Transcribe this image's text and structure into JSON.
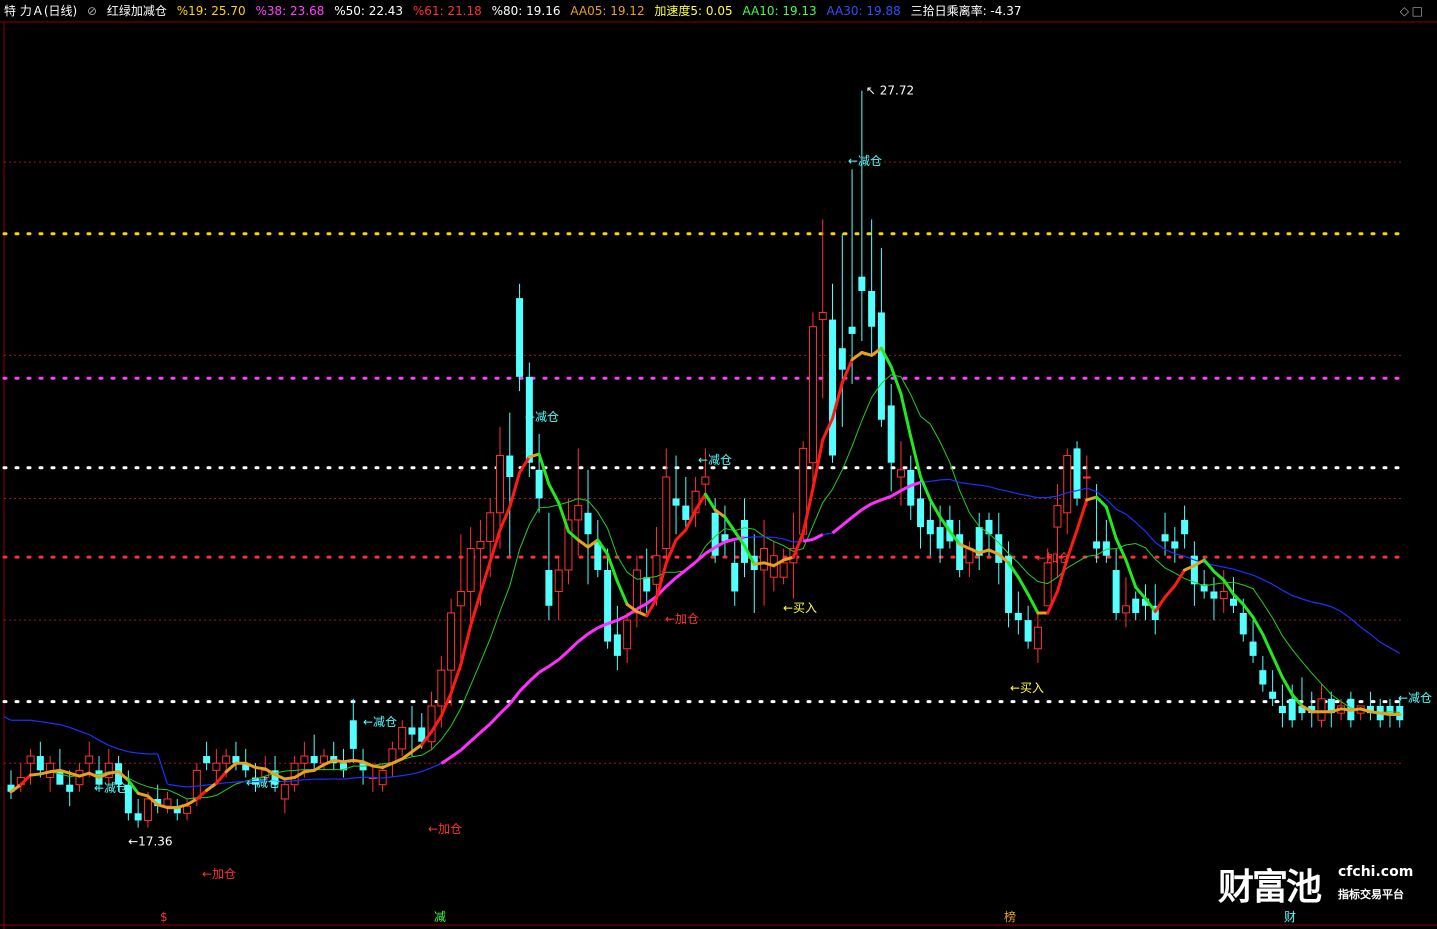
{
  "header": {
    "stock": "特 力Ａ(日线)",
    "indicator": "红绿加减仓",
    "items": [
      {
        "label": "%19: 25.70",
        "color": "#ffd400"
      },
      {
        "label": "%38: 23.68",
        "color": "#ff40ff"
      },
      {
        "label": "%50: 22.43",
        "color": "#ffffff"
      },
      {
        "label": "%61: 21.18",
        "color": "#ff3030"
      },
      {
        "label": "%80: 19.16",
        "color": "#ffffff"
      },
      {
        "label": "AA05: 19.12",
        "color": "#e8a020"
      },
      {
        "label": "加速度5: 0.05",
        "color": "#ffff40"
      },
      {
        "label": "AA10: 19.13",
        "color": "#40ff40"
      },
      {
        "label": "AA30: 19.88",
        "color": "#3050ff"
      },
      {
        "label": "三拾日乘离率: -4.37",
        "color": "#ffffff"
      }
    ]
  },
  "colors": {
    "up": "#ff3232",
    "down": "#54ffff",
    "ma5_rise": "#ff1a1a",
    "ma5_fall": "#22e822",
    "ma5_flat": "#e8a020",
    "ma10": "#22cc22",
    "ma30": "#2030ff",
    "ma30_up": "#ff30ff"
  },
  "chart_data": {
    "type": "candlestick",
    "ylim": [
      16.5,
      28.1
    ],
    "high_label": "27.72",
    "low_label": "17.36",
    "levels": [
      {
        "value": 25.7,
        "color": "#ffd400",
        "style": "dotted"
      },
      {
        "value": 23.68,
        "color": "#ff40ff",
        "style": "dotted"
      },
      {
        "value": 22.43,
        "color": "#ffffff",
        "style": "dotted"
      },
      {
        "value": 21.18,
        "color": "#ff3030",
        "style": "dotted"
      },
      {
        "value": 19.16,
        "color": "#ffffff",
        "style": "dotted"
      }
    ],
    "gridlines": [
      26.7,
      24.0,
      22.0,
      20.3,
      18.3
    ],
    "candles": [
      [
        18.0,
        18.2,
        17.8,
        17.9
      ],
      [
        18.0,
        18.3,
        17.9,
        18.1
      ],
      [
        18.3,
        18.5,
        18.0,
        18.4
      ],
      [
        18.4,
        18.6,
        18.1,
        18.2
      ],
      [
        18.1,
        18.4,
        17.9,
        18.3
      ],
      [
        18.2,
        18.5,
        18.0,
        18.0
      ],
      [
        18.0,
        18.2,
        17.7,
        17.9
      ],
      [
        18.0,
        18.3,
        17.9,
        18.2
      ],
      [
        18.3,
        18.6,
        18.1,
        18.4
      ],
      [
        18.2,
        18.4,
        17.9,
        18.0
      ],
      [
        18.1,
        18.5,
        18.0,
        18.3
      ],
      [
        18.3,
        18.4,
        17.9,
        18.0
      ],
      [
        18.0,
        18.2,
        17.5,
        17.6
      ],
      [
        17.6,
        17.8,
        17.4,
        17.5
      ],
      [
        17.5,
        17.9,
        17.4,
        17.8
      ],
      [
        17.8,
        18.0,
        17.6,
        17.7
      ],
      [
        17.7,
        17.9,
        17.6,
        17.8
      ],
      [
        17.7,
        17.8,
        17.5,
        17.6
      ],
      [
        17.6,
        17.8,
        17.5,
        17.7
      ],
      [
        17.8,
        18.3,
        17.7,
        18.2
      ],
      [
        18.4,
        18.6,
        18.2,
        18.3
      ],
      [
        18.2,
        18.5,
        18.0,
        18.3
      ],
      [
        18.3,
        18.5,
        18.1,
        18.4
      ],
      [
        18.4,
        18.6,
        18.2,
        18.3
      ],
      [
        18.3,
        18.5,
        18.1,
        18.2
      ],
      [
        18.1,
        18.3,
        17.9,
        18.0
      ],
      [
        18.1,
        18.4,
        18.0,
        18.2
      ],
      [
        18.2,
        18.4,
        17.9,
        18.0
      ],
      [
        17.8,
        18.1,
        17.6,
        18.0
      ],
      [
        18.0,
        18.4,
        17.9,
        18.3
      ],
      [
        18.3,
        18.6,
        18.1,
        18.4
      ],
      [
        18.4,
        18.7,
        18.2,
        18.3
      ],
      [
        18.3,
        18.5,
        18.2,
        18.4
      ],
      [
        18.4,
        18.6,
        18.2,
        18.3
      ],
      [
        18.3,
        18.5,
        18.1,
        18.2
      ],
      [
        18.9,
        19.2,
        18.3,
        18.5
      ],
      [
        18.3,
        18.5,
        18.0,
        18.2
      ],
      [
        18.1,
        18.3,
        17.9,
        18.1
      ],
      [
        18.0,
        18.3,
        17.9,
        18.2
      ],
      [
        18.3,
        18.6,
        18.1,
        18.5
      ],
      [
        18.5,
        18.9,
        18.4,
        18.8
      ],
      [
        18.8,
        19.1,
        18.4,
        18.7
      ],
      [
        18.8,
        19.0,
        18.5,
        18.6
      ],
      [
        18.6,
        19.3,
        18.5,
        19.1
      ],
      [
        19.1,
        19.8,
        18.8,
        19.6
      ],
      [
        19.6,
        20.6,
        19.1,
        20.4
      ],
      [
        20.5,
        21.5,
        19.6,
        20.7
      ],
      [
        20.7,
        21.6,
        20.2,
        21.3
      ],
      [
        21.3,
        21.7,
        20.5,
        21.4
      ],
      [
        21.4,
        22.0,
        20.9,
        21.8
      ],
      [
        21.8,
        23.0,
        21.3,
        22.6
      ],
      [
        22.6,
        23.2,
        21.2,
        22.3
      ],
      [
        24.8,
        25.0,
        23.5,
        23.7
      ],
      [
        23.7,
        23.9,
        22.3,
        22.5
      ],
      [
        22.4,
        22.9,
        21.8,
        22.0
      ],
      [
        21.0,
        21.8,
        20.3,
        20.5
      ],
      [
        20.7,
        21.2,
        20.3,
        21.0
      ],
      [
        21.0,
        22.0,
        20.8,
        21.7
      ],
      [
        21.7,
        22.7,
        21.2,
        21.9
      ],
      [
        21.8,
        22.4,
        20.8,
        21.5
      ],
      [
        21.4,
        21.7,
        20.9,
        21.0
      ],
      [
        21.0,
        21.3,
        19.9,
        20.0
      ],
      [
        20.1,
        20.5,
        19.6,
        19.8
      ],
      [
        19.9,
        20.4,
        19.7,
        20.3
      ],
      [
        20.4,
        21.2,
        20.2,
        21.0
      ],
      [
        20.9,
        21.3,
        20.4,
        20.7
      ],
      [
        20.8,
        21.6,
        20.5,
        21.2
      ],
      [
        21.3,
        22.7,
        21.1,
        22.3
      ],
      [
        22.0,
        22.6,
        21.5,
        21.9
      ],
      [
        21.9,
        22.3,
        21.6,
        21.7
      ],
      [
        21.8,
        22.3,
        21.6,
        22.1
      ],
      [
        22.2,
        22.7,
        21.9,
        22.3
      ],
      [
        21.8,
        22.0,
        21.1,
        21.2
      ],
      [
        21.5,
        21.9,
        21.2,
        21.4
      ],
      [
        21.1,
        21.4,
        20.5,
        20.7
      ],
      [
        21.7,
        22.0,
        20.9,
        21.1
      ],
      [
        21.2,
        21.5,
        20.4,
        21.0
      ],
      [
        21.0,
        21.7,
        20.5,
        21.3
      ],
      [
        20.9,
        21.4,
        20.7,
        21.2
      ],
      [
        20.9,
        21.3,
        20.8,
        21.1
      ],
      [
        21.1,
        21.8,
        20.6,
        21.3
      ],
      [
        21.5,
        22.8,
        21.4,
        22.7
      ],
      [
        22.5,
        24.6,
        22.1,
        24.4
      ],
      [
        24.5,
        25.9,
        23.4,
        24.6
      ],
      [
        24.5,
        25.0,
        22.5,
        22.6
      ],
      [
        24.1,
        25.7,
        23.0,
        23.8
      ],
      [
        24.4,
        26.6,
        23.6,
        24.3
      ],
      [
        25.1,
        27.7,
        24.2,
        24.9
      ],
      [
        24.9,
        25.9,
        24.0,
        24.4
      ],
      [
        24.6,
        25.5,
        23.0,
        23.1
      ],
      [
        23.3,
        23.6,
        22.1,
        22.5
      ],
      [
        22.3,
        22.8,
        21.9,
        22.4
      ],
      [
        22.4,
        22.6,
        21.7,
        21.9
      ],
      [
        22.0,
        22.3,
        21.3,
        21.6
      ],
      [
        21.7,
        22.0,
        21.2,
        21.5
      ],
      [
        21.6,
        21.9,
        21.1,
        21.3
      ],
      [
        21.7,
        21.9,
        21.3,
        21.4
      ],
      [
        21.5,
        21.7,
        20.9,
        21.0
      ],
      [
        21.1,
        21.4,
        20.9,
        21.3
      ],
      [
        21.6,
        21.8,
        21.0,
        21.2
      ],
      [
        21.7,
        21.8,
        21.2,
        21.5
      ],
      [
        21.5,
        21.8,
        20.8,
        21.1
      ],
      [
        21.2,
        21.4,
        20.2,
        20.4
      ],
      [
        20.4,
        20.7,
        20.1,
        20.3
      ],
      [
        20.3,
        20.5,
        19.9,
        20.0
      ],
      [
        19.9,
        20.4,
        19.7,
        20.2
      ],
      [
        20.5,
        21.3,
        20.5,
        21.1
      ],
      [
        21.6,
        22.2,
        20.9,
        21.9
      ],
      [
        21.8,
        22.7,
        21.5,
        22.6
      ],
      [
        22.7,
        22.8,
        21.9,
        22.0
      ],
      [
        22.3,
        22.6,
        21.9,
        22.3
      ],
      [
        21.4,
        22.2,
        21.1,
        21.3
      ],
      [
        21.4,
        21.7,
        21.1,
        21.2
      ],
      [
        21.0,
        21.3,
        20.3,
        20.4
      ],
      [
        20.4,
        20.9,
        20.2,
        20.5
      ],
      [
        20.6,
        20.7,
        20.3,
        20.4
      ],
      [
        20.6,
        20.8,
        20.3,
        20.5
      ],
      [
        20.5,
        20.8,
        20.1,
        20.3
      ],
      [
        21.5,
        21.8,
        21.2,
        21.4
      ],
      [
        21.4,
        21.6,
        21.1,
        21.3
      ],
      [
        21.7,
        21.9,
        21.3,
        21.5
      ],
      [
        21.2,
        21.4,
        20.5,
        20.8
      ],
      [
        20.8,
        21.0,
        20.6,
        20.7
      ],
      [
        20.7,
        20.9,
        20.3,
        20.6
      ],
      [
        20.6,
        21.0,
        20.4,
        20.7
      ],
      [
        20.6,
        20.9,
        20.4,
        20.5
      ],
      [
        20.4,
        20.6,
        20.0,
        20.1
      ],
      [
        20.0,
        20.3,
        19.7,
        19.8
      ],
      [
        19.6,
        19.8,
        19.3,
        19.4
      ],
      [
        19.3,
        19.6,
        19.1,
        19.2
      ],
      [
        19.1,
        19.4,
        18.8,
        19.0
      ],
      [
        19.2,
        19.4,
        18.8,
        18.9
      ],
      [
        19.1,
        19.5,
        18.9,
        19.0
      ],
      [
        19.1,
        19.3,
        18.8,
        19.0
      ],
      [
        18.9,
        19.4,
        18.8,
        19.2
      ],
      [
        19.2,
        19.3,
        18.8,
        19.0
      ],
      [
        19.0,
        19.2,
        18.9,
        19.1
      ],
      [
        19.2,
        19.3,
        18.8,
        18.9
      ],
      [
        19.0,
        19.1,
        18.9,
        19.1
      ],
      [
        19.1,
        19.3,
        18.9,
        19.0
      ],
      [
        19.1,
        19.2,
        18.8,
        18.9
      ],
      [
        19.1,
        19.2,
        18.8,
        19.0
      ],
      [
        19.1,
        19.2,
        18.8,
        18.9
      ]
    ],
    "ma30_flat": [
      18.9,
      18.9,
      18.9,
      18.88,
      18.86,
      18.84,
      18.8,
      18.75,
      18.7,
      18.62,
      18.55,
      18.5,
      18.46,
      18.44,
      18.43,
      18.43
    ],
    "annotations": [
      {
        "label": "←减仓",
        "x": 94,
        "y": 787,
        "color": "#54ffff"
      },
      {
        "label": "←减仓",
        "x": 246,
        "y": 782,
        "color": "#54ffff"
      },
      {
        "label": "←减仓",
        "x": 363,
        "y": 721,
        "color": "#54ffff"
      },
      {
        "label": "←减仓",
        "x": 525,
        "y": 416,
        "color": "#54ffff"
      },
      {
        "label": "←减仓",
        "x": 698,
        "y": 459,
        "color": "#54ffff"
      },
      {
        "label": "←减仓",
        "x": 848,
        "y": 160,
        "color": "#54ffff"
      },
      {
        "label": "←减仓",
        "x": 1398,
        "y": 697,
        "color": "#54ffff"
      },
      {
        "label": "←加仓",
        "x": 202,
        "y": 873,
        "color": "#ff3232"
      },
      {
        "label": "←加仓",
        "x": 428,
        "y": 828,
        "color": "#ff3232"
      },
      {
        "label": "←加仓",
        "x": 665,
        "y": 618,
        "color": "#ff3232"
      },
      {
        "label": "←加仓",
        "x": 1036,
        "y": 557,
        "color": "#ff3232"
      },
      {
        "label": "←买入",
        "x": 783,
        "y": 607,
        "color": "#ffff40"
      },
      {
        "label": "←买入",
        "x": 1010,
        "y": 687,
        "color": "#ffff40"
      }
    ],
    "bottom_markers": [
      {
        "label": "$",
        "x": 166,
        "color": "#ff3232"
      },
      {
        "label": "减",
        "x": 440,
        "color": "#40ff40"
      },
      {
        "label": "榜",
        "x": 1010,
        "color": "#e8a020"
      },
      {
        "label": "财",
        "x": 1290,
        "color": "#54ffff"
      }
    ]
  },
  "logo": {
    "main": "财富池",
    "domain": "cfchi.com",
    "sub": "指标交易平台"
  }
}
